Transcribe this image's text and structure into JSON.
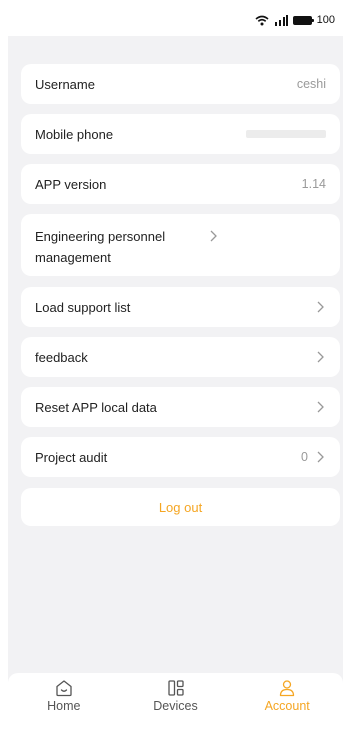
{
  "status_bar": {
    "battery": "100"
  },
  "rows": {
    "username": {
      "label": "Username",
      "value": "ceshi"
    },
    "mobile_phone": {
      "label": "Mobile phone"
    },
    "app_version": {
      "label": "APP version",
      "value": "1.14"
    },
    "engineering": {
      "label": "Engineering personnel management"
    },
    "load_support": {
      "label": "Load support list"
    },
    "feedback": {
      "label": "feedback"
    },
    "reset": {
      "label": "Reset APP local data"
    },
    "project_audit": {
      "label": "Project audit",
      "value": "0"
    }
  },
  "logout_label": "Log out",
  "tabs": {
    "home": "Home",
    "devices": "Devices",
    "account": "Account"
  },
  "colors": {
    "accent": "#f5a623",
    "page_bg": "#f2f2f4",
    "card_bg": "#ffffff",
    "value_text": "#9a9a9a"
  }
}
